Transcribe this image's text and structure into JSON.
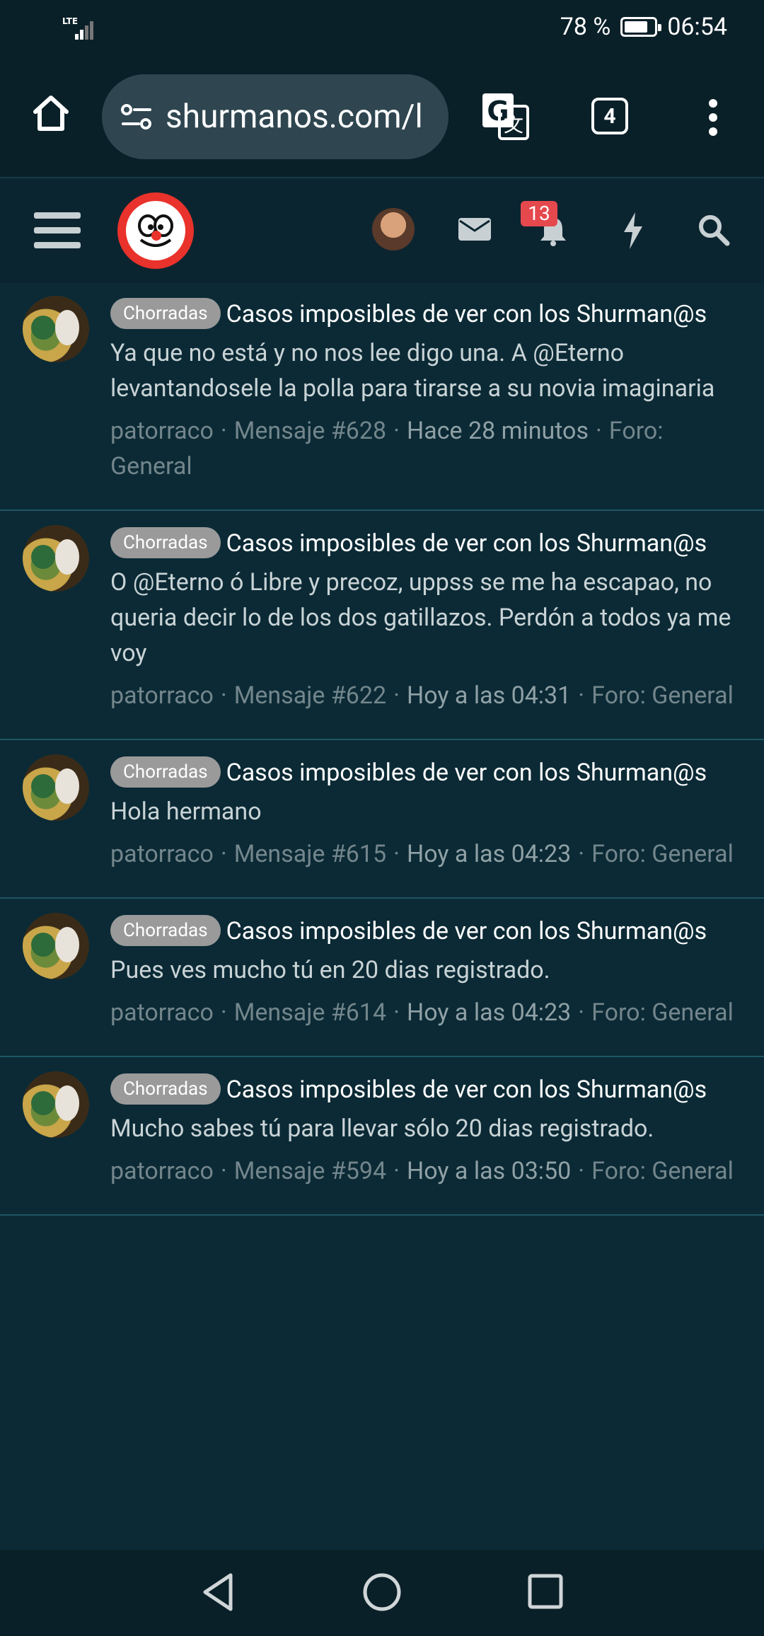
{
  "status_bar": {
    "network": "LTE",
    "battery_percent": "78 %",
    "battery_level": 0.78,
    "time": "06:54"
  },
  "browser": {
    "url": "shurmanos.com/l",
    "tab_count": "4",
    "icons": [
      "home-icon",
      "site-info-icon",
      "translate-icon",
      "tabs-icon",
      "more-icon"
    ]
  },
  "site_header": {
    "notification_count": "13",
    "icons": [
      "menu-icon",
      "logo",
      "avatar",
      "mail-icon",
      "bell-icon",
      "bolt-icon",
      "search-icon"
    ]
  },
  "colors": {
    "background": "#0b2a35",
    "header": "#0a2028",
    "tag": "#9a9a9a",
    "badge": "#e5484d",
    "logo": "#e8322b"
  },
  "posts": [
    {
      "tag": "Chorradas",
      "title": "Casos imposibles de ver con los Shurman@s",
      "body": "Ya que no está y no nos lee digo una. A @Eterno levantandosele la polla para tirarse a su novia imaginaria",
      "author": "patorraco",
      "message": "Mensaje #628",
      "date": "Hace 28 minutos",
      "forum": "Foro: General"
    },
    {
      "tag": "Chorradas",
      "title": "Casos imposibles de ver con los Shurman@s",
      "body": "O @Eterno ó Libre y precoz, uppss se me ha escapao, no queria decir lo de los dos gatillazos. Perdón a todos ya me voy",
      "author": "patorraco",
      "message": "Mensaje #622",
      "date": "Hoy a las 04:31",
      "forum": "Foro: General"
    },
    {
      "tag": "Chorradas",
      "title": "Casos imposibles de ver con los Shurman@s",
      "body": "Hola hermano",
      "author": "patorraco",
      "message": "Mensaje #615",
      "date": "Hoy a las 04:23",
      "forum": "Foro: General"
    },
    {
      "tag": "Chorradas",
      "title": "Casos imposibles de ver con los Shurman@s",
      "body": "Pues ves mucho tú en 20 dias registrado.",
      "author": "patorraco",
      "message": "Mensaje #614",
      "date": "Hoy a las 04:23",
      "forum": "Foro: General"
    },
    {
      "tag": "Chorradas",
      "title": "Casos imposibles de ver con los Shurman@s",
      "body": "Mucho sabes tú para llevar sólo 20 dias registrado.",
      "author": "patorraco",
      "message": "Mensaje #594",
      "date": "Hoy a las 03:50",
      "forum": "Foro: General"
    }
  ]
}
